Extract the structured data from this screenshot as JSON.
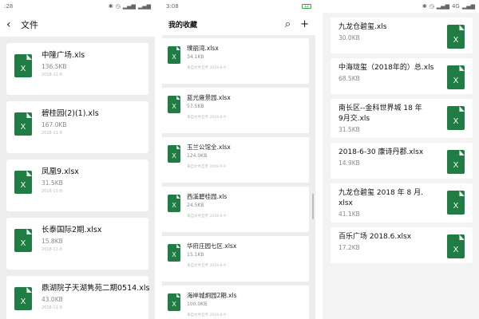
{
  "colors": {
    "excel_green": "#1f7c43",
    "background": "#ededed",
    "card": "#ffffff"
  },
  "icons": {
    "file": "excel-file-icon",
    "back": "back-arrow-icon",
    "search": "search-icon",
    "add": "plus-icon"
  },
  "panel1": {
    "status_time": ":28",
    "title": "文件",
    "files": [
      {
        "name": "中隆广场.xls",
        "size": "136.5KB",
        "date": "2018-11-8",
        "icon": "X"
      },
      {
        "name": "碧桂园(2)(1).xls",
        "size": "167.0KB",
        "date": "2018-11-8",
        "icon": "X"
      },
      {
        "name": "凤凰9.xlsx",
        "size": "31.5KB",
        "date": "2018-11-8",
        "icon": "X"
      },
      {
        "name": "长泰国际2期.xlsx",
        "size": "15.8KB",
        "date": "2018-11-8",
        "icon": "X"
      },
      {
        "name": "鼎湖院子天湖隽苑二期0514.xls",
        "size": "43.0KB",
        "date": "2018-11-8",
        "icon": "X"
      }
    ]
  },
  "panel2": {
    "status_time": "3:08",
    "battery": "12",
    "title": "我的收藏",
    "files": [
      {
        "name": "璞丽湾.xlsx",
        "size": "34.1KB",
        "source": "来自文件互传",
        "date": "2018-6-9",
        "icon": "X"
      },
      {
        "name": "蓝光雍景园.xlsx",
        "size": "57.5KB",
        "source": "来自文件互传",
        "date": "2018-6-9",
        "icon": "X"
      },
      {
        "name": "玉兰公馆全.xlsx",
        "size": "124.0KB",
        "source": "来自文件互传",
        "date": "2018-6-9",
        "icon": "X"
      },
      {
        "name": "西溪碧桂园.xls",
        "size": "24.5KB",
        "source": "来自文件互传",
        "date": "2018-6-9",
        "icon": "X"
      },
      {
        "name": "华府庄园七区.xlsx",
        "size": "15.1KB",
        "source": "来自文件互传",
        "date": "2018-6-9",
        "icon": "X"
      },
      {
        "name": "海岸城炯园2期.xls",
        "size": "100.0KB",
        "source": "来自文件互传",
        "date": "2018-6-9",
        "icon": "X"
      }
    ]
  },
  "panel3": {
    "network": "4G",
    "files": [
      {
        "name_lines": [
          "九龙仓碧玺.xls"
        ],
        "size": "30.0KB",
        "icon": "X"
      },
      {
        "name_lines": [
          "中海珑玺（2018年的）总.xls"
        ],
        "size": "68.5KB",
        "icon": "X"
      },
      {
        "name_lines": [
          "南长区--金科世界城 18 年",
          "9月交.xls"
        ],
        "size": "31.5KB",
        "icon": "X"
      },
      {
        "name_lines": [
          "2018-6-30 康诗丹郡.xlsx"
        ],
        "size": "14.9KB",
        "icon": "X"
      },
      {
        "name_lines": [
          "九龙仓碧玺 2018 年 8 月.",
          "xlsx"
        ],
        "size": "41.1KB",
        "icon": "X"
      },
      {
        "name_lines": [
          "百乐广场 2018.6.xlsx"
        ],
        "size": "17.2KB",
        "icon": "X"
      }
    ]
  }
}
